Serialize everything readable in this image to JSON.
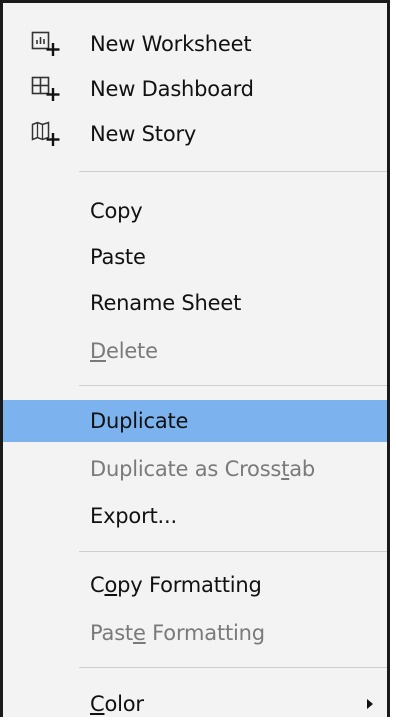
{
  "menu": {
    "items": [
      {
        "id": "new-worksheet",
        "label": "New Worksheet",
        "icon": "new-worksheet-icon",
        "disabled": false
      },
      {
        "id": "new-dashboard",
        "label": "New Dashboard",
        "icon": "new-dashboard-icon",
        "disabled": false
      },
      {
        "id": "new-story",
        "label": "New Story",
        "icon": "new-story-icon",
        "disabled": false
      },
      {
        "id": "copy",
        "label": "Copy",
        "disabled": false
      },
      {
        "id": "paste",
        "label": "Paste",
        "disabled": false
      },
      {
        "id": "rename-sheet",
        "label": "Rename Sheet",
        "disabled": false
      },
      {
        "id": "delete",
        "label": "Delete",
        "underline_char": "D",
        "disabled": true
      },
      {
        "id": "duplicate",
        "label": "Duplicate",
        "disabled": false,
        "highlighted": true
      },
      {
        "id": "duplicate-as-crosstab",
        "label": "Duplicate as Crosstab",
        "underline_char": "t",
        "disabled": true
      },
      {
        "id": "export",
        "label": "Export...",
        "disabled": false
      },
      {
        "id": "copy-formatting",
        "label": "Copy Formatting",
        "underline_char": "o",
        "disabled": false
      },
      {
        "id": "paste-formatting",
        "label": "Paste Formatting",
        "underline_char": "e",
        "disabled": true
      },
      {
        "id": "color",
        "label": "Color",
        "underline_char": "C",
        "disabled": false,
        "submenu": true
      }
    ]
  },
  "colors": {
    "menu_background": "#f3f3f3",
    "highlight": "#7cb2ee",
    "text": "#111111",
    "disabled_text": "#7a7a7a",
    "separator": "#cfcfcf",
    "border": "#1a1a1a"
  }
}
